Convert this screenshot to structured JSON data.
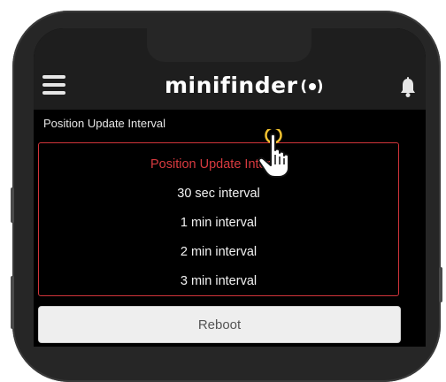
{
  "app": {
    "brand": "minifinder",
    "icons": {
      "menu": "hamburger-menu-icon",
      "notifications": "bell-icon",
      "brand_mark": "signal-dot-icon",
      "cursor": "hand-pointer-cursor-icon"
    },
    "colors": {
      "accent": "#d83a3f",
      "appbar": "#1e1e1e",
      "screen": "#000000"
    }
  },
  "settings": {
    "section_label": "Position Update Interval",
    "dropdown": {
      "selected": "Position Update Interval",
      "options": [
        "Position Update Interval",
        "30 sec interval",
        "1 min interval",
        "2 min interval",
        "3 min interval"
      ]
    },
    "reboot_label": "Reboot"
  }
}
